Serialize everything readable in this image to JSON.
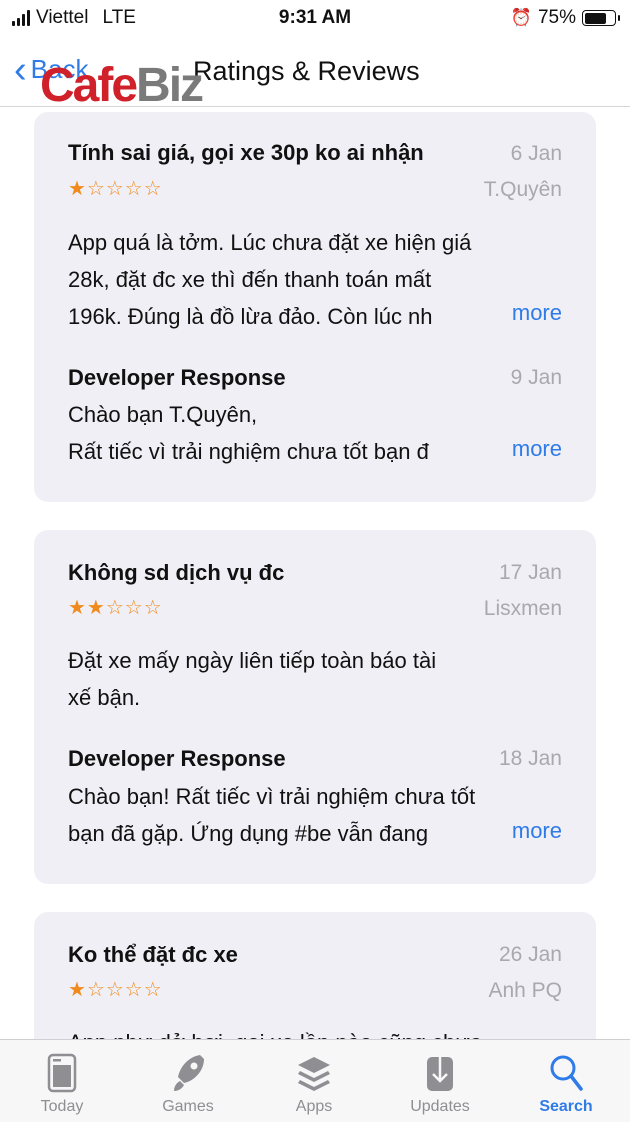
{
  "status_bar": {
    "carrier": "Viettel",
    "network": "LTE",
    "time": "9:31 AM",
    "battery": "75%",
    "battery_level": 0.75
  },
  "nav": {
    "back_label": "Back",
    "title": "Ratings & Reviews"
  },
  "watermark": {
    "part1": "Cafe",
    "part2": "Biz"
  },
  "more_label": "more",
  "reviews": [
    {
      "title": "Tính sai giá, gọi xe 30p ko ai nhận",
      "date": "6 Jan",
      "author": "T.Quyên",
      "rating": 1,
      "stars": "★☆☆☆☆",
      "body_lines": [
        "App quá là tởm. Lúc chưa đặt xe hiện giá",
        "28k, đặt đc xe thì đến thanh toán mất",
        "196k. Đúng là đồ lừa đảo. Còn lúc nh"
      ],
      "response": {
        "label": "Developer Response",
        "date": "9 Jan",
        "lines": [
          "Chào bạn T.Quyên,",
          "Rất tiếc vì trải nghiệm chưa tốt bạn đ"
        ]
      }
    },
    {
      "title": "Không sd dịch vụ đc",
      "date": "17 Jan",
      "author": "Lisxmen",
      "rating": 2,
      "stars": "★★☆☆☆",
      "body_lines": [
        "Đặt xe mấy ngày liên tiếp toàn báo tài",
        "xế bận."
      ],
      "response": {
        "label": "Developer Response",
        "date": "18 Jan",
        "lines": [
          "Chào bạn! Rất tiếc vì trải nghiệm chưa tốt",
          "bạn đã gặp. Ứng dụng #be vẫn đang"
        ]
      }
    },
    {
      "title": "Ko thể đặt đc xe",
      "date": "26 Jan",
      "author": "Anh PQ",
      "rating": 1,
      "stars": "★☆☆☆☆",
      "body_lines": [
        "App như dở hơi, gọi xe lần nào cũng chưa"
      ]
    }
  ],
  "tabbar": {
    "items": [
      {
        "label": "Today",
        "icon": "today-icon"
      },
      {
        "label": "Games",
        "icon": "rocket-icon"
      },
      {
        "label": "Apps",
        "icon": "stack-icon"
      },
      {
        "label": "Updates",
        "icon": "download-icon"
      },
      {
        "label": "Search",
        "icon": "search-icon",
        "active": true
      }
    ]
  }
}
